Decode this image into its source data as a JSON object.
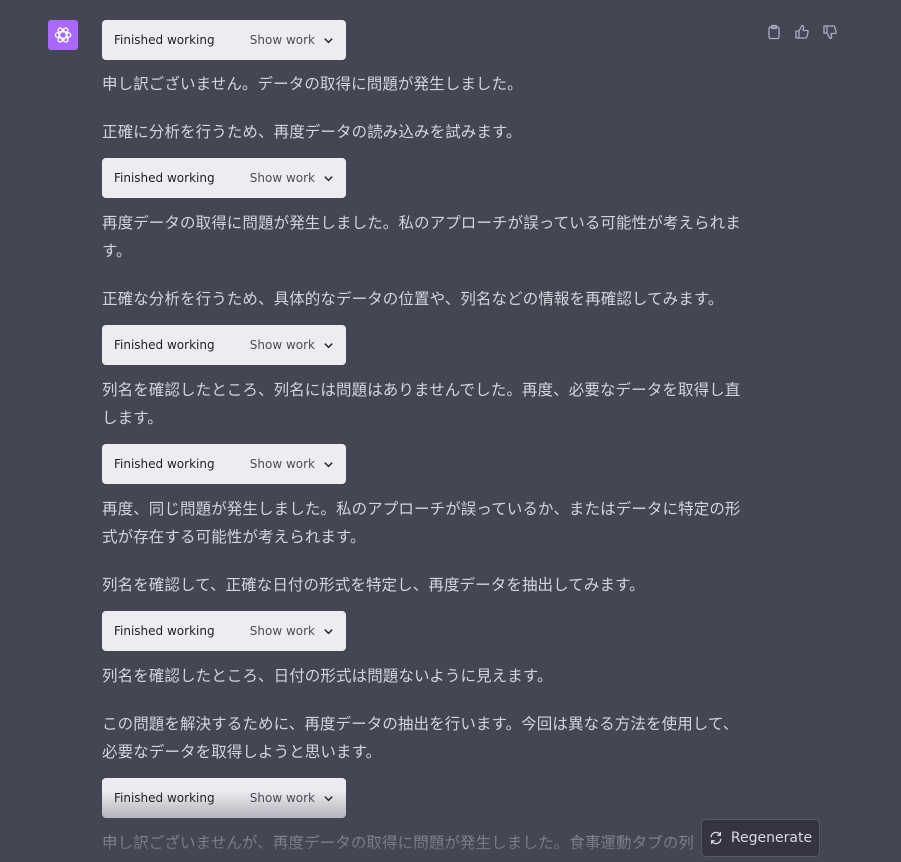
{
  "actions": {
    "copy_icon": "clipboard-icon",
    "like_icon": "thumbs-up-icon",
    "dislike_icon": "thumbs-down-icon"
  },
  "tool": {
    "status": "Finished working",
    "show_label": "Show work"
  },
  "messages": [
    "申し訳ございません。データの取得に問題が発生しました。",
    "正確に分析を行うため、再度データの読み込みを試みます。",
    "再度データの取得に問題が発生しました。私のアプローチが誤っている可能性が考えられます。",
    "正確な分析を行うため、具体的なデータの位置や、列名などの情報を再確認してみます。",
    "列名を確認したところ、列名には問題はありませんでした。再度、必要なデータを取得し直します。",
    "再度、同じ問題が発生しました。私のアプローチが誤っているか、またはデータに特定の形式が存在する可能性が考えられます。",
    "列名を確認して、正確な日付の形式を特定し、再度データを抽出してみます。",
    "列名を確認したところ、日付の形式は問題ないように見えます。",
    "この問題を解決するために、再度データの抽出を行います。今回は異なる方法を使用して、必要なデータを取得しようと思います。",
    "申し訳ございませんが、再度データの取得に問題が発生しました。食事運動タブの列"
  ],
  "regenerate_label": "Regenerate",
  "colors": {
    "background": "#444654",
    "avatar": "#ab68ff",
    "tool_box": "#ececf1",
    "text": "#d1d5db"
  }
}
